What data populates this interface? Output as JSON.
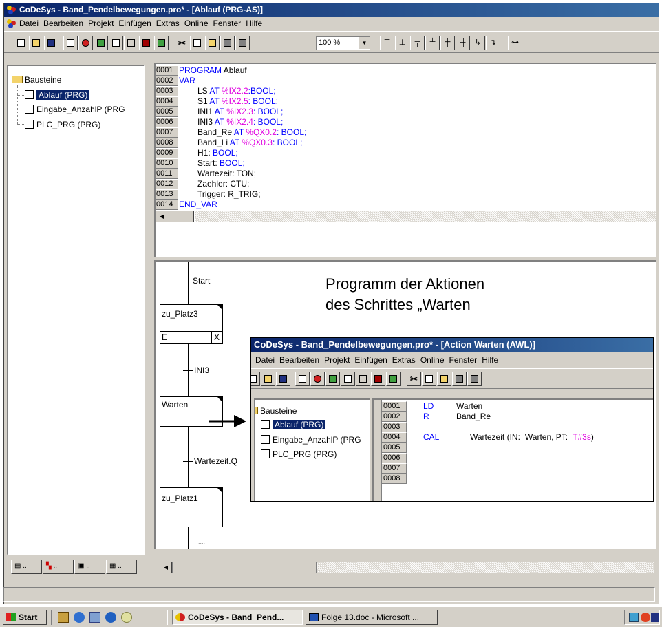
{
  "window": {
    "title": "CoDeSys - Band_Pendelbewegungen.pro* - [Ablauf (PRG-AS)]",
    "menu": [
      "Datei",
      "Bearbeiten",
      "Projekt",
      "Einfügen",
      "Extras",
      "Online",
      "Fenster",
      "Hilfe"
    ],
    "zoom": "100 %"
  },
  "tree": {
    "root": "Bausteine",
    "items": [
      "Ablauf (PRG)",
      "Eingabe_AnzahlP (PRG",
      "PLC_PRG (PRG)"
    ],
    "selected_index": 0
  },
  "declaration": {
    "line_numbers": [
      "0001",
      "0002",
      "0003",
      "0004",
      "0005",
      "0006",
      "0007",
      "0008",
      "0009",
      "0010",
      "0011",
      "0012",
      "0013",
      "0014"
    ],
    "l1": {
      "kw": "PROGRAM",
      "name": " Ablauf"
    },
    "l2": {
      "kw": "VAR"
    },
    "l3": {
      "name": "LS",
      "at": " AT ",
      "addr": "%IX2.2",
      "type": ":BOOL;"
    },
    "l4": {
      "name": "S1",
      "at": " AT ",
      "addr": "%IX2.5",
      "type": ": BOOL;"
    },
    "l5": {
      "name": "INI1",
      "at": " AT ",
      "addr": "%IX2.3",
      "type": ": BOOL;"
    },
    "l6": {
      "name": "INI3",
      "at": " AT ",
      "addr": "%IX2.4",
      "type": ": BOOL;"
    },
    "l7": {
      "name": "Band_Re",
      "at": " AT ",
      "addr": "%QX0.2",
      "type": ": BOOL;"
    },
    "l8": {
      "name": "Band_Li",
      "at": " AT ",
      "addr": "%QX0.3",
      "type": ": BOOL;"
    },
    "l9": {
      "name": "H1: ",
      "type": "BOOL;"
    },
    "l10": {
      "name": "Start: ",
      "type": "BOOL;"
    },
    "l11": {
      "name": "Wartezeit: TON;"
    },
    "l12": {
      "name": "Zaehler: CTU;"
    },
    "l13": {
      "name": "Trigger: R_TRIG;"
    },
    "l14": {
      "kw": "END_VAR"
    }
  },
  "sfc": {
    "start_label": "Start",
    "step1": "zu_Platz3",
    "step1_e": "E",
    "step1_x": "X",
    "trans1": "INI3",
    "step2": "Warten",
    "trans2": "Wartezeit.Q",
    "step3": "zu_Platz1",
    "dots": "...."
  },
  "caption": {
    "line1": "Programm der  Aktionen",
    "line2": "des Schrittes „Warten"
  },
  "popup": {
    "title": "CoDeSys - Band_Pendelbewegungen.pro* - [Action Warten (AWL)]",
    "menu": [
      "Datei",
      "Bearbeiten",
      "Projekt",
      "Einfügen",
      "Extras",
      "Online",
      "Fenster",
      "Hilfe"
    ],
    "tree_root": "Bausteine",
    "tree_items": [
      "Ablauf (PRG)",
      "Eingabe_AnzahlP (PRG",
      "PLC_PRG (PRG)"
    ],
    "line_numbers": [
      "0001",
      "0002",
      "0003",
      "0004",
      "0005",
      "0006",
      "0007",
      "0008"
    ],
    "code": {
      "op1": "LD",
      "arg1": "Warten",
      "op2": "R",
      "arg2": "Band_Re",
      "op4": "CAL",
      "arg4a": "Wartezeit (IN:=Warten, PT:=",
      "arg4b": "T#3s",
      "arg4c": ")"
    }
  },
  "taskbar": {
    "start": "Start",
    "task1": "CoDeSys - Band_Pend...",
    "task2": "Folge 13.doc - Microsoft ..."
  },
  "colors": {
    "keyword": "#0000ff",
    "address": "#e000e0",
    "titlebar": "#0a246a",
    "selection": "#0a246a"
  }
}
